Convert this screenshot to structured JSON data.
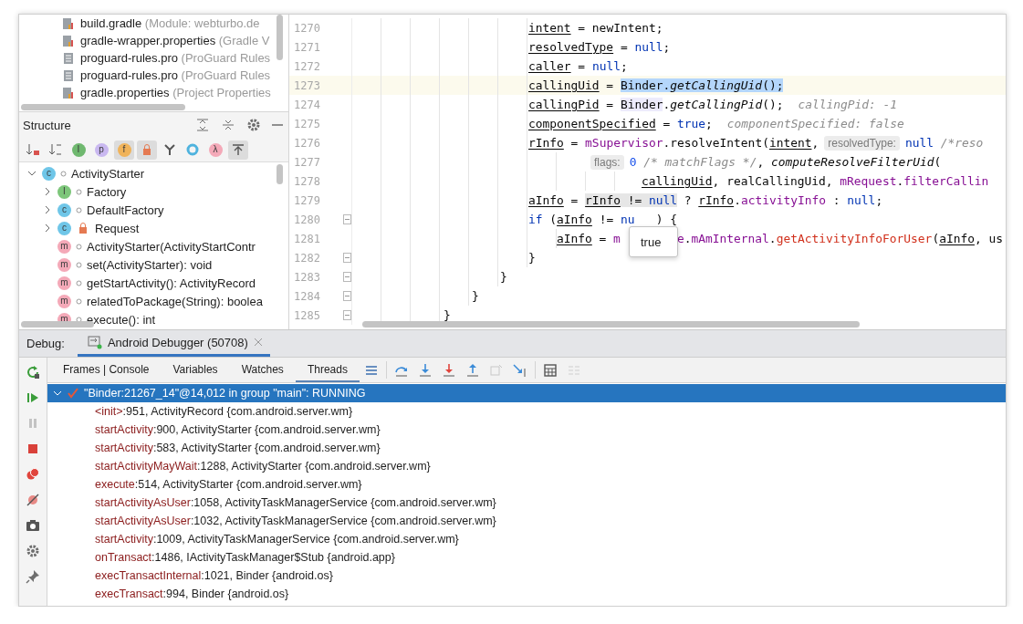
{
  "project_files": [
    {
      "name": "build.gradle",
      "detail": "(Module: webturbo.de",
      "kind": "gradle"
    },
    {
      "name": "gradle-wrapper.properties",
      "detail": "(Gradle V",
      "kind": "gradle"
    },
    {
      "name": "proguard-rules.pro",
      "detail": "(ProGuard Rules",
      "kind": "text"
    },
    {
      "name": "proguard-rules.pro",
      "detail": "(ProGuard Rules",
      "kind": "text"
    },
    {
      "name": "gradle.properties",
      "detail": "(Project Properties",
      "kind": "gradle"
    }
  ],
  "structure": {
    "title": "Structure",
    "toolbar": [
      {
        "kind": "sort-visibility",
        "on": false
      },
      {
        "kind": "sort-alpha",
        "on": false
      },
      {
        "kind": "badge",
        "badge": "I",
        "color": "#6fb86f",
        "on": false
      },
      {
        "kind": "badge",
        "badge": "p",
        "color": "#c9b8f0",
        "on": false
      },
      {
        "kind": "badge",
        "badge": "f",
        "color": "#f0b35a",
        "on": true
      },
      {
        "kind": "lock",
        "on": true
      },
      {
        "kind": "branch",
        "on": false
      },
      {
        "kind": "ring",
        "on": false
      },
      {
        "kind": "badge",
        "badge": "λ",
        "color": "#f4a9b8",
        "on": false
      },
      {
        "kind": "autoscroll",
        "on": true
      }
    ],
    "tree": [
      {
        "name": "ActivityStarter",
        "kind": "class",
        "badge": "c",
        "private": false,
        "expanded": true,
        "children": [
          {
            "name": "Factory",
            "kind": "interface",
            "badge": "I",
            "private": false,
            "expanded": false
          },
          {
            "name": "DefaultFactory",
            "kind": "class",
            "badge": "c",
            "private": false,
            "expanded": false
          },
          {
            "name": "Request",
            "kind": "class",
            "badge": "c",
            "private": true,
            "expanded": false
          },
          {
            "name": "ActivityStarter(ActivityStartContr",
            "kind": "method",
            "badge": "m",
            "private": false
          },
          {
            "name": "set(ActivityStarter): void",
            "kind": "method",
            "badge": "m",
            "private": false
          },
          {
            "name": "getStartActivity(): ActivityRecord",
            "kind": "method",
            "badge": "m",
            "private": false
          },
          {
            "name": "relatedToPackage(String): boolea",
            "kind": "method",
            "badge": "m",
            "private": false
          },
          {
            "name": "execute(): int",
            "kind": "method",
            "badge": "m",
            "private": false
          }
        ]
      }
    ]
  },
  "editor": {
    "tooltip": "true",
    "lines": [
      {
        "number": "1270",
        "current": false,
        "fold": false,
        "tokens": [
          {
            "text": "intent",
            "kind": "var"
          },
          {
            "text": " = newIntent;",
            "kind": "plain"
          }
        ]
      },
      {
        "number": "1271",
        "current": false,
        "fold": false,
        "tokens": [
          {
            "text": "resolvedType",
            "kind": "var"
          },
          {
            "text": " = ",
            "kind": "plain"
          },
          {
            "text": "null",
            "kind": "keyword"
          },
          {
            "text": ";",
            "kind": "plain"
          }
        ]
      },
      {
        "number": "1272",
        "current": false,
        "fold": false,
        "tokens": [
          {
            "text": "caller",
            "kind": "var"
          },
          {
            "text": " = ",
            "kind": "plain"
          },
          {
            "text": "null",
            "kind": "keyword"
          },
          {
            "text": ";",
            "kind": "plain"
          }
        ]
      },
      {
        "number": "1273",
        "current": true,
        "fold": false,
        "tokens": [
          {
            "text": "callingUid",
            "kind": "var"
          },
          {
            "text": " = ",
            "kind": "plain"
          },
          {
            "text": "Binder.",
            "kind": "sel-plain"
          },
          {
            "text": "getCallingUid",
            "kind": "sel-static"
          },
          {
            "text": "();",
            "kind": "sel-plain"
          }
        ]
      },
      {
        "number": "1274",
        "current": false,
        "fold": false,
        "tokens": [
          {
            "text": "callingPid",
            "kind": "var"
          },
          {
            "text": " = ",
            "kind": "plain"
          },
          {
            "text": "Binder",
            "kind": "usage"
          },
          {
            "text": ".",
            "kind": "plain"
          },
          {
            "text": "getCallingPid",
            "kind": "static"
          },
          {
            "text": "();",
            "kind": "plain"
          },
          {
            "text": "callingPid: -1",
            "kind": "hint"
          }
        ]
      },
      {
        "number": "1275",
        "current": false,
        "fold": false,
        "tokens": [
          {
            "text": "componentSpecified",
            "kind": "var"
          },
          {
            "text": " = ",
            "kind": "plain"
          },
          {
            "text": "true",
            "kind": "keyword"
          },
          {
            "text": ";",
            "kind": "plain"
          },
          {
            "text": "componentSpecified: false",
            "kind": "hint"
          }
        ]
      },
      {
        "number": "1276",
        "current": false,
        "fold": false,
        "tokens": [
          {
            "text": "rInfo",
            "kind": "var"
          },
          {
            "text": " = ",
            "kind": "plain"
          },
          {
            "text": "mSupervisor",
            "kind": "field"
          },
          {
            "text": ".resolveIntent(",
            "kind": "plain"
          },
          {
            "text": "intent",
            "kind": "var"
          },
          {
            "text": ",",
            "kind": "plain"
          },
          {
            "text": "resolvedType:",
            "kind": "inlay"
          },
          {
            "text": "null",
            "kind": "keyword"
          },
          {
            "text": " /*reso",
            "kind": "comment"
          }
        ]
      },
      {
        "number": "1277",
        "current": false,
        "fold": false,
        "tokens": [
          {
            "text": "flags:",
            "kind": "inlay"
          },
          {
            "text": "0",
            "kind": "number"
          },
          {
            "text": " /* matchFlags */",
            "kind": "comment"
          },
          {
            "text": ", ",
            "kind": "plain"
          },
          {
            "text": "computeResolveFilterUid",
            "kind": "static"
          },
          {
            "text": "(",
            "kind": "plain"
          }
        ]
      },
      {
        "number": "1278",
        "current": false,
        "fold": false,
        "tokens": [
          {
            "text": "callingUid",
            "kind": "var"
          },
          {
            "text": ", realCallingUid, ",
            "kind": "plain"
          },
          {
            "text": "mRequest",
            "kind": "field"
          },
          {
            "text": ".",
            "kind": "plain"
          },
          {
            "text": "filterCallin",
            "kind": "field"
          }
        ]
      },
      {
        "number": "1279",
        "current": false,
        "fold": false,
        "tokens": [
          {
            "text": "aInfo",
            "kind": "var"
          },
          {
            "text": " = ",
            "kind": "plain"
          },
          {
            "text": "rInfo",
            "kind": "eval-var"
          },
          {
            "text": " != ",
            "kind": "eval-plain"
          },
          {
            "text": "null",
            "kind": "eval-keyword"
          },
          {
            "text": " ? ",
            "kind": "plain"
          },
          {
            "text": "rInfo",
            "kind": "var"
          },
          {
            "text": ".",
            "kind": "plain"
          },
          {
            "text": "activityInfo",
            "kind": "field"
          },
          {
            "text": " : ",
            "kind": "plain"
          },
          {
            "text": "null",
            "kind": "keyword"
          },
          {
            "text": ";",
            "kind": "plain"
          }
        ]
      },
      {
        "number": "1280",
        "current": false,
        "fold": true,
        "tokens": [
          {
            "text": "if",
            "kind": "keyword"
          },
          {
            "text": " (",
            "kind": "plain"
          },
          {
            "text": "aInfo",
            "kind": "var"
          },
          {
            "text": " != ",
            "kind": "plain"
          },
          {
            "text": "nu",
            "kind": "keyword"
          },
          {
            "kind": "hidden-short"
          },
          {
            "text": ") {",
            "kind": "plain"
          }
        ]
      },
      {
        "number": "1281",
        "current": false,
        "fold": false,
        "tokens": [
          {
            "text": "aInfo",
            "kind": "var"
          },
          {
            "text": " = ",
            "kind": "plain"
          },
          {
            "text": "m",
            "kind": "field"
          },
          {
            "kind": "hidden-long"
          },
          {
            "text": "e",
            "kind": "field"
          },
          {
            "text": ".",
            "kind": "plain"
          },
          {
            "text": "mAmInternal",
            "kind": "field"
          },
          {
            "text": ".",
            "kind": "plain"
          },
          {
            "text": "getActivityInfoForUser",
            "kind": "call"
          },
          {
            "text": "(",
            "kind": "plain"
          },
          {
            "text": "aInfo",
            "kind": "var"
          },
          {
            "text": ", us",
            "kind": "plain"
          }
        ]
      },
      {
        "number": "1282",
        "current": false,
        "fold": true,
        "tokens": [
          {
            "text": "}",
            "kind": "plain"
          }
        ]
      },
      {
        "number": "1283",
        "current": false,
        "fold": true,
        "tokens": [
          {
            "text": "}",
            "kind": "plain"
          }
        ]
      },
      {
        "number": "1284",
        "current": false,
        "fold": true,
        "tokens": [
          {
            "text": "}",
            "kind": "plain"
          }
        ]
      },
      {
        "number": "1285",
        "current": false,
        "fold": true,
        "tokens": [
          {
            "text": "}",
            "kind": "plain"
          }
        ]
      }
    ]
  },
  "debug": {
    "label": "Debug:",
    "session_tab": {
      "label": "Android Debugger (50708)",
      "selected": true
    },
    "side_tools": [
      {
        "kind": "rerun",
        "disabled": false
      },
      {
        "kind": "resume",
        "disabled": false
      },
      {
        "kind": "pause",
        "disabled": true
      },
      {
        "kind": "stop",
        "disabled": false
      },
      {
        "kind": "breakpoints",
        "disabled": false
      },
      {
        "kind": "mute",
        "disabled": false
      },
      {
        "kind": "camera",
        "disabled": false
      },
      {
        "kind": "settings",
        "disabled": false
      },
      {
        "kind": "pin",
        "disabled": false
      }
    ],
    "tabs": [
      {
        "label": "Frames | Console",
        "selected": false
      },
      {
        "label": "Variables",
        "selected": false
      },
      {
        "label": "Watches",
        "selected": false
      },
      {
        "label": "Threads",
        "selected": true
      }
    ],
    "tools": [
      {
        "kind": "menu",
        "disabled": false
      },
      {
        "kind": "step-over",
        "disabled": false
      },
      {
        "kind": "step-into",
        "disabled": false
      },
      {
        "kind": "force-step-into",
        "disabled": false
      },
      {
        "kind": "step-out",
        "disabled": false
      },
      {
        "kind": "drop-frame",
        "disabled": true
      },
      {
        "kind": "run-to-cursor",
        "disabled": false
      },
      {
        "kind": "evaluate",
        "disabled": false
      },
      {
        "kind": "trace",
        "disabled": true
      }
    ],
    "threads": [
      {
        "name": "\"Binder:21267_14\"@14,012 in group \"main\": RUNNING",
        "expanded": true,
        "selected": true,
        "frames": [
          {
            "method": "<init>",
            "location": ":951, ActivityRecord {com.android.server.wm}",
            "selected": false
          },
          {
            "method": "startActivity",
            "location": ":900, ActivityStarter {com.android.server.wm}",
            "selected": false
          },
          {
            "method": "startActivity",
            "location": ":583, ActivityStarter {com.android.server.wm}",
            "selected": false
          },
          {
            "method": "startActivityMayWait",
            "location": ":1288, ActivityStarter {com.android.server.wm}",
            "selected": false
          },
          {
            "method": "execute",
            "location": ":514, ActivityStarter {com.android.server.wm}",
            "selected": false
          },
          {
            "method": "startActivityAsUser",
            "location": ":1058, ActivityTaskManagerService {com.android.server.wm}",
            "selected": false
          },
          {
            "method": "startActivityAsUser",
            "location": ":1032, ActivityTaskManagerService {com.android.server.wm}",
            "selected": false
          },
          {
            "method": "startActivity",
            "location": ":1009, ActivityTaskManagerService {com.android.server.wm}",
            "selected": false
          },
          {
            "method": "onTransact",
            "location": ":1486, IActivityTaskManager$Stub {android.app}",
            "selected": false
          },
          {
            "method": "execTransactInternal",
            "location": ":1021, Binder {android.os}",
            "selected": false
          },
          {
            "method": "execTransact",
            "location": ":994, Binder {android.os}",
            "selected": false
          }
        ]
      }
    ]
  }
}
